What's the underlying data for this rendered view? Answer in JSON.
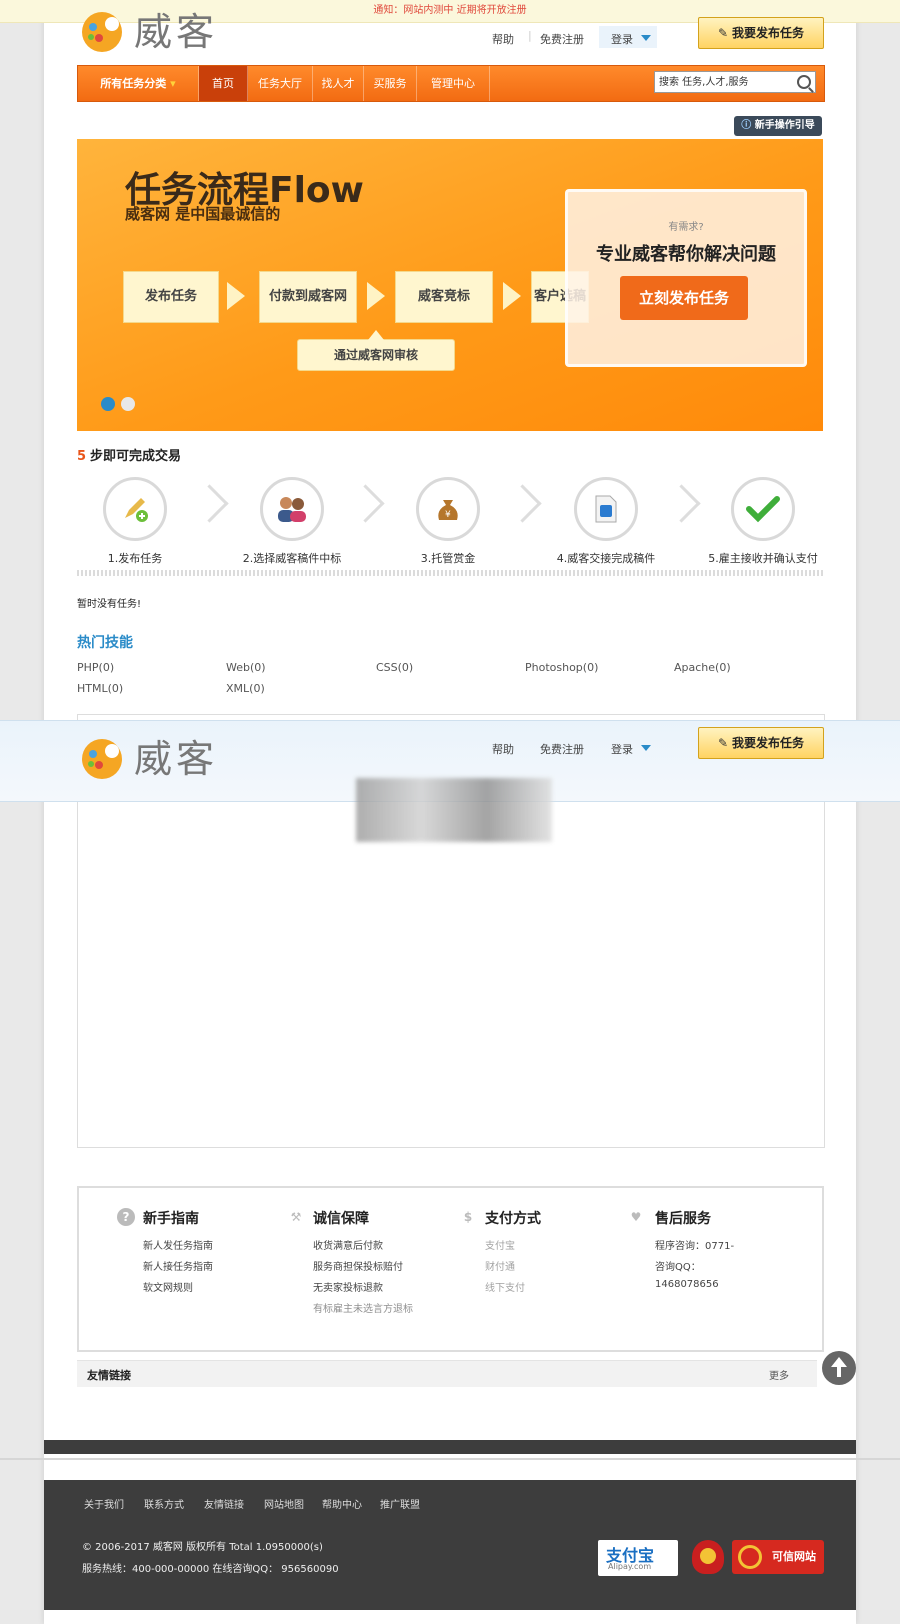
{
  "notice": "通知：网站内测中 近期将开放注册",
  "logo": {
    "text": "威客"
  },
  "top_links": {
    "help": "帮助",
    "register": "免费注册",
    "login": "登录"
  },
  "publish_button": "我要发布任务",
  "nav": {
    "all_categories": "所有任务分类",
    "items": [
      "首页",
      "任务大厅",
      "找人才",
      "买服务",
      "管理中心"
    ],
    "search_placeholder": "搜索 任务,人才,服务"
  },
  "guide_button": "新手操作引导",
  "banner": {
    "title": "任务流程Flow",
    "subtitle": "威客网 是中国最诚信的",
    "flow": [
      "发布任务",
      "付款到威客网",
      "威客竞标",
      "客户选稿"
    ],
    "review": "通过威客网审核",
    "overlay_question": "有需求?",
    "overlay_title": "专业威客帮你解决问题",
    "overlay_button": "立刻发布任务"
  },
  "steps": {
    "num": "5",
    "title": "步即可完成交易",
    "items": [
      "1.发布任务",
      "2.选择威客稿件中标",
      "3.托管赏金",
      "4.威客交接完成稿件",
      "5.雇主接收并确认支付"
    ]
  },
  "empty_message": "暂时没有任务!",
  "skills": {
    "title": "热门技能",
    "items": [
      "PHP(0)",
      "Web(0)",
      "CSS(0)",
      "Photoshop(0)",
      "Apache(0)",
      "HTML(0)",
      "XML(0)"
    ]
  },
  "footer_cols": [
    {
      "title": "新手指南",
      "items": [
        "新人发任务指南",
        "新人接任务指南",
        "软文网规则"
      ]
    },
    {
      "title": "诚信保障",
      "items": [
        "收货满意后付款",
        "服务商担保投标赔付",
        "无卖家投标退款",
        "有标雇主未选言方退标"
      ]
    },
    {
      "title": "支付方式",
      "items": [
        "支付宝",
        "财付通",
        "线下支付"
      ]
    },
    {
      "title": "售后服务",
      "items": [
        "程序咨询：0771-",
        "咨询QQ：",
        "1468078656"
      ]
    }
  ],
  "friend_links": {
    "title": "友情链接",
    "more": "更多"
  },
  "footer": {
    "links": [
      "关于我们",
      "联系方式",
      "友情链接",
      "网站地图",
      "帮助中心",
      "推广联盟"
    ],
    "copyright": "© 2006-2017 威客网 版权所有 Total 1.0950000(s)",
    "hotline": "服务热线：400-000-00000 在线咨询QQ： 956560090",
    "badges": {
      "alipay": "支付宝",
      "alipay_sub": "Alipay.com",
      "cx": "可信网站"
    }
  },
  "colors": {
    "brand_orange": "#f26b12",
    "accent_blue": "#2a8bc8",
    "notice_red": "#e0493c"
  }
}
